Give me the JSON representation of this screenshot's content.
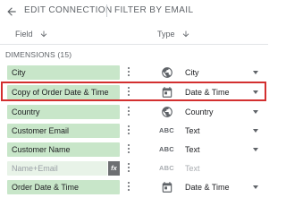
{
  "header": {
    "title": "EDIT CONNECTION",
    "filter_label": "FILTER BY EMAIL"
  },
  "columns": {
    "field": "Field",
    "type": "Type"
  },
  "dimensions_label": "DIMENSIONS (15)",
  "rows": [
    {
      "field": "City",
      "type": "City",
      "type_icon": "globe-icon"
    },
    {
      "field": "Copy of Order Date & Time",
      "type": "Date & Time",
      "type_icon": "calendar-icon",
      "highlighted": true
    },
    {
      "field": "Country",
      "type": "Country",
      "type_icon": "globe-icon"
    },
    {
      "field": "Customer Email",
      "type": "Text",
      "type_icon": "text-type-icon",
      "type_icon_text": "ABC"
    },
    {
      "field": "Customer Name",
      "type": "Text",
      "type_icon": "text-type-icon",
      "type_icon_text": "ABC"
    },
    {
      "field": "Name+Email",
      "fx_label": "fx",
      "type": "Text",
      "type_icon": "text-type-icon",
      "type_icon_text": "ABC",
      "calculated": true
    },
    {
      "field": "Order Date & Time",
      "type": "Date & Time",
      "type_icon": "calendar-icon"
    }
  ],
  "colors": {
    "field_chip": "#c8e6c9",
    "calculated_chip": "#e8f3e8",
    "highlight": "#d32f2f"
  }
}
